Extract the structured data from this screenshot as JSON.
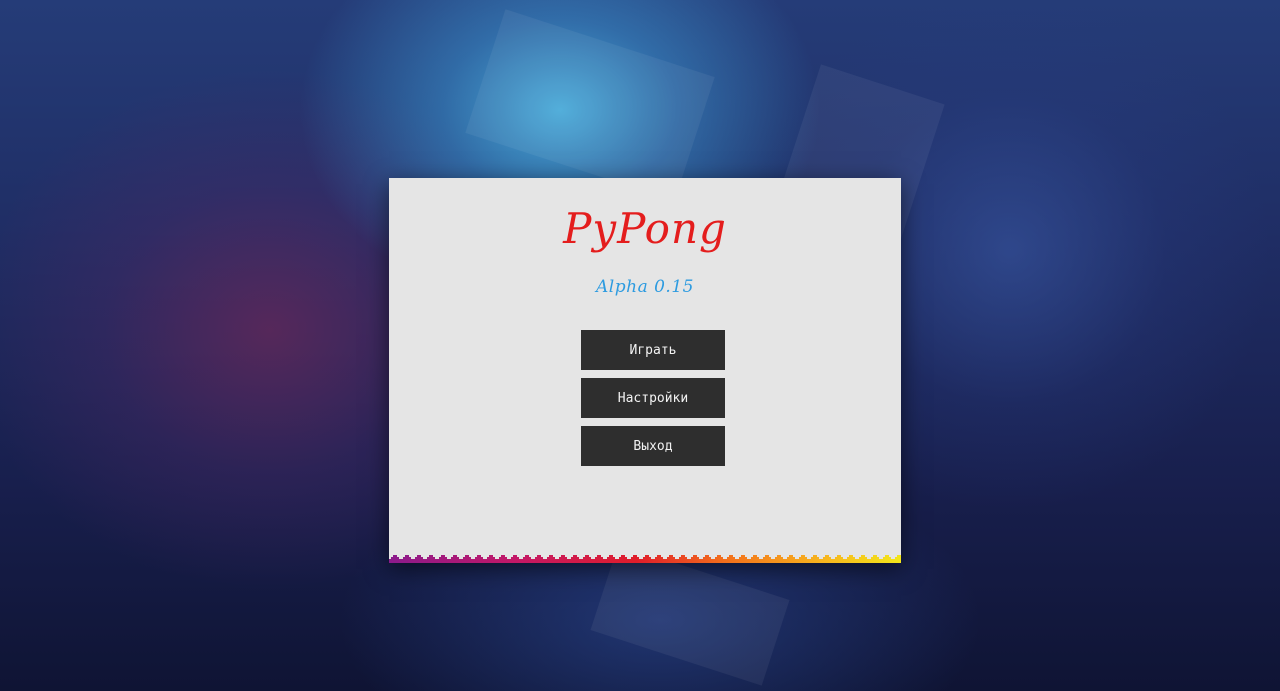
{
  "app": {
    "title": "PyPong",
    "version": "Alpha 0.15"
  },
  "menu": {
    "play_label": "Играть",
    "settings_label": "Настройки",
    "exit_label": "Выход"
  },
  "colors": {
    "title": "#e41d1d",
    "version": "#2d9be0",
    "button_bg": "#2e2e2e",
    "button_text": "#f2f2f2",
    "window_bg": "#e5e5e5",
    "strip_gradient": [
      "#8b1a8c",
      "#c41866",
      "#e01d2a",
      "#f36f1c",
      "#f7b81e",
      "#f3e91a"
    ]
  }
}
